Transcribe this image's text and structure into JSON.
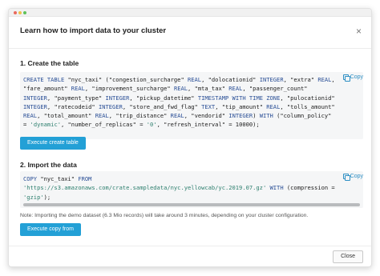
{
  "dialog": {
    "title": "Learn how to import data to your cluster",
    "close_symbol": "×"
  },
  "step1": {
    "title": "1. Create the table",
    "copy_label": "Copy",
    "code_tokens": [
      [
        [
          "kw",
          "CREATE TABLE"
        ],
        [
          "t",
          " \"nyc_taxi\" (\"congestion_surcharge\" "
        ],
        [
          "kw",
          "REAL"
        ],
        [
          "t",
          ", \"dolocationid\" "
        ],
        [
          "kw",
          "INTEGER"
        ],
        [
          "t",
          ", \"extra\" "
        ],
        [
          "kw",
          "REAL"
        ],
        [
          "t",
          ","
        ]
      ],
      [
        [
          "t",
          "\"fare_amount\" "
        ],
        [
          "kw",
          "REAL"
        ],
        [
          "t",
          ", \"improvement_surcharge\" "
        ],
        [
          "kw",
          "REAL"
        ],
        [
          "t",
          ", \"mta_tax\" "
        ],
        [
          "kw",
          "REAL"
        ],
        [
          "t",
          ", \"passenger_count\""
        ]
      ],
      [
        [
          "kw",
          "INTEGER"
        ],
        [
          "t",
          ", \"payment_type\" "
        ],
        [
          "kw",
          "INTEGER"
        ],
        [
          "t",
          ", \"pickup_datetime\" "
        ],
        [
          "kw",
          "TIMESTAMP WITH TIME ZONE"
        ],
        [
          "t",
          ", \"pulocationid\""
        ]
      ],
      [
        [
          "kw",
          "INTEGER"
        ],
        [
          "t",
          ", \"ratecodeid\" "
        ],
        [
          "kw",
          "INTEGER"
        ],
        [
          "t",
          ", \"store_and_fwd_flag\" "
        ],
        [
          "kw",
          "TEXT"
        ],
        [
          "t",
          ", \"tip_amount\" "
        ],
        [
          "kw",
          "REAL"
        ],
        [
          "t",
          ", \"tolls_amount\""
        ]
      ],
      [
        [
          "kw",
          "REAL"
        ],
        [
          "t",
          ", \"total_amount\" "
        ],
        [
          "kw",
          "REAL"
        ],
        [
          "t",
          ", \"trip_distance\" "
        ],
        [
          "kw",
          "REAL"
        ],
        [
          "t",
          ", \"vendorid\" "
        ],
        [
          "kw",
          "INTEGER"
        ],
        [
          "t",
          ") "
        ],
        [
          "kw",
          "WITH"
        ],
        [
          "t",
          " (\"column_policy\""
        ]
      ],
      [
        [
          "t",
          "= "
        ],
        [
          "str",
          "'dynamic'"
        ],
        [
          "t",
          ", \"number_of_replicas\" = "
        ],
        [
          "str",
          "'0'"
        ],
        [
          "t",
          ", \"refresh_interval\" = 10000);"
        ]
      ]
    ],
    "button_label": "Execute create table"
  },
  "step2": {
    "title": "2. Import the data",
    "copy_label": "Copy",
    "code_tokens": [
      [
        [
          "kw",
          "COPY"
        ],
        [
          "t",
          " \"nyc_taxi\" "
        ],
        [
          "kw",
          "FROM"
        ]
      ],
      [
        [
          "str",
          "'https://s3.amazonaws.com/crate.sampledata/nyc.yellowcab/yc.2019.07.gz'"
        ],
        [
          "t",
          " "
        ],
        [
          "kw",
          "WITH"
        ],
        [
          "t",
          " (compression ="
        ]
      ],
      [
        [
          "str",
          "'gzip'"
        ],
        [
          "t",
          ");"
        ]
      ]
    ],
    "note": "Note: Importing the demo dataset (6.3 Mio records) will take around 3 minutes, depending on your cluster configuration.",
    "button_label": "Execute copy from"
  },
  "footer": {
    "close_label": "Close"
  },
  "icons": {
    "copy": "copy-icon",
    "close": "close-icon"
  },
  "colors": {
    "accent": "#23a0d6",
    "keyword": "#2a4f96",
    "string": "#2d7f6e",
    "code_background": "#f5f6f7"
  }
}
